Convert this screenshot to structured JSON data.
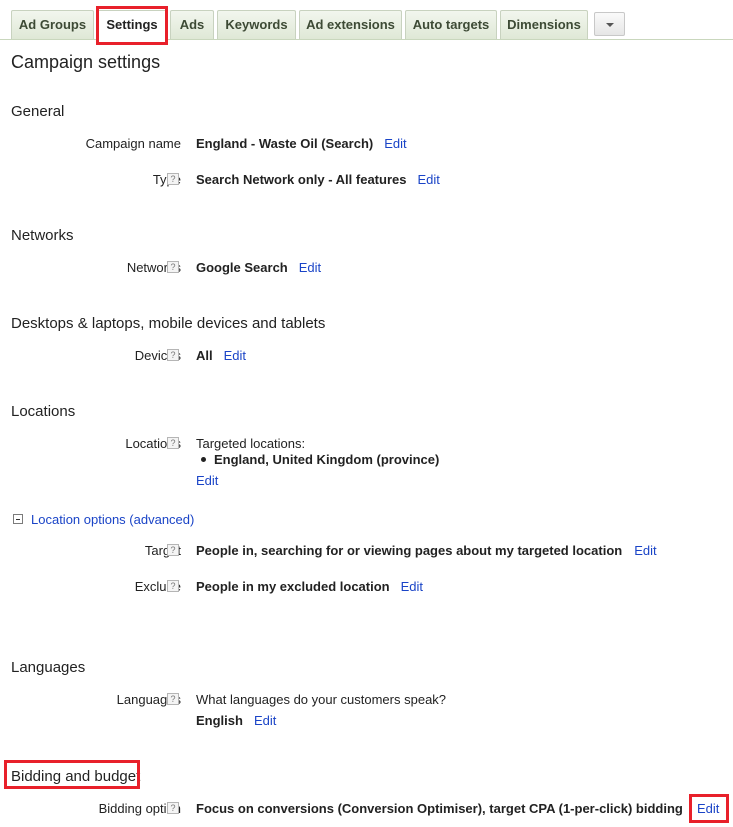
{
  "tabs": [
    {
      "label": "Ad Groups"
    },
    {
      "label": "Settings"
    },
    {
      "label": "Ads"
    },
    {
      "label": "Keywords"
    },
    {
      "label": "Ad extensions"
    },
    {
      "label": "Auto targets"
    },
    {
      "label": "Dimensions"
    }
  ],
  "active_tab": "Settings",
  "page_title": "Campaign settings",
  "general": {
    "heading": "General",
    "campaign_name": {
      "label": "Campaign name",
      "value": "England - Waste Oil (Search)",
      "edit": "Edit"
    },
    "type": {
      "label": "Type",
      "help": "?",
      "value": "Search Network only - All features",
      "edit": "Edit"
    }
  },
  "networks": {
    "heading": "Networks",
    "row": {
      "label": "Networks",
      "help": "?",
      "value": "Google Search",
      "edit": "Edit"
    }
  },
  "devices": {
    "heading": "Desktops & laptops, mobile devices and tablets",
    "row": {
      "label": "Devices",
      "help": "?",
      "value": "All",
      "edit": "Edit"
    }
  },
  "locations": {
    "heading": "Locations",
    "row": {
      "label": "Locations",
      "help": "?",
      "intro": "Targeted locations:",
      "items": [
        "England, United Kingdom (province)"
      ],
      "edit": "Edit"
    },
    "advanced_link": "Location options (advanced)",
    "target": {
      "label": "Target",
      "help": "?",
      "value": "People in, searching for or viewing pages about my targeted location",
      "edit": "Edit"
    },
    "exclude": {
      "label": "Exclude",
      "help": "?",
      "value": "People in my excluded location",
      "edit": "Edit"
    }
  },
  "languages": {
    "heading": "Languages",
    "row": {
      "label": "Languages",
      "help": "?",
      "question": "What languages do your customers speak?",
      "value": "English",
      "edit": "Edit"
    }
  },
  "bidding": {
    "heading": "Bidding and budget",
    "row": {
      "label": "Bidding option",
      "help": "?",
      "value": "Focus on conversions (Conversion Optimiser), target CPA (1-per-click) bidding",
      "edit": "Edit"
    }
  },
  "colors": {
    "highlight": "#e8202a",
    "link": "#1a44c7",
    "tab_bg": "#dfe8d6"
  }
}
